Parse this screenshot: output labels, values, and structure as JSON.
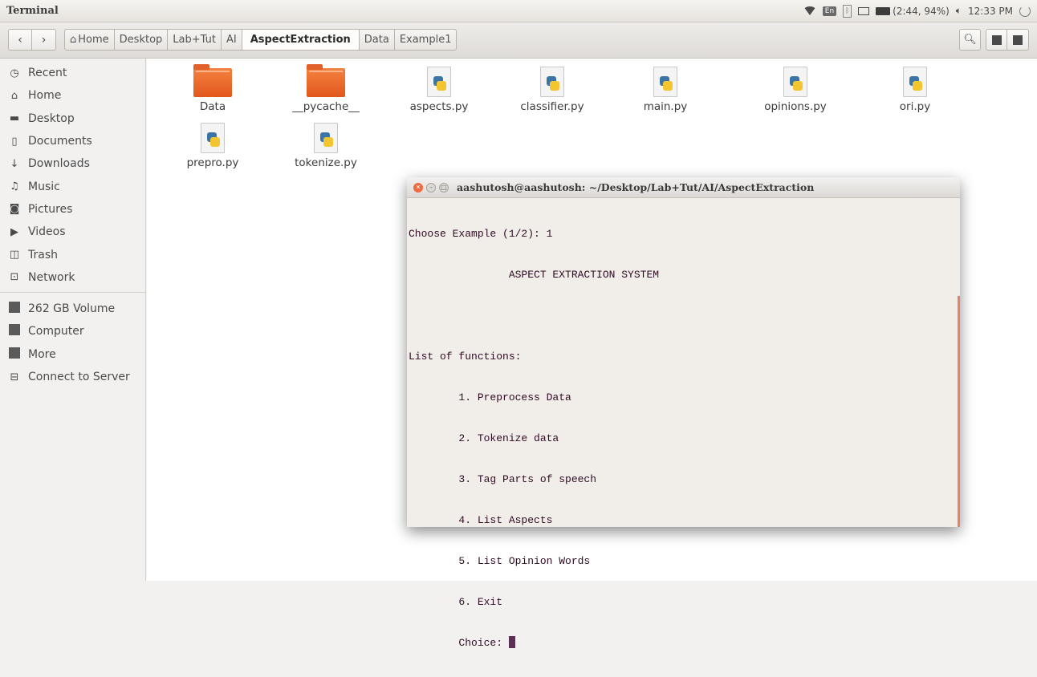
{
  "top_panel": {
    "app_title": "Terminal",
    "keyboard_layout": "En",
    "battery": "(2:44, 94%)",
    "clock": "12:33 PM"
  },
  "toolbar": {
    "back_icon": "chevron-left",
    "forward_icon": "chevron-right",
    "breadcrumbs": [
      "Home",
      "Desktop",
      "Lab+Tut",
      "AI",
      "AspectExtraction",
      "Data",
      "Example1"
    ],
    "active_crumb": "AspectExtraction"
  },
  "sidebar": {
    "places": [
      {
        "label": "Recent",
        "icon": "clock-icon"
      },
      {
        "label": "Home",
        "icon": "home-icon"
      },
      {
        "label": "Desktop",
        "icon": "desktop-folder-icon"
      },
      {
        "label": "Documents",
        "icon": "document-icon"
      },
      {
        "label": "Downloads",
        "icon": "download-icon"
      },
      {
        "label": "Music",
        "icon": "music-icon"
      },
      {
        "label": "Pictures",
        "icon": "camera-icon"
      },
      {
        "label": "Videos",
        "icon": "video-icon"
      },
      {
        "label": "Trash",
        "icon": "trash-icon"
      },
      {
        "label": "Network",
        "icon": "network-icon"
      }
    ],
    "devices": [
      {
        "label": "262 GB Volume",
        "icon": "drive-icon"
      },
      {
        "label": "Computer",
        "icon": "drive-icon"
      },
      {
        "label": "More",
        "icon": "drive-icon"
      },
      {
        "label": "Connect to Server",
        "icon": "server-icon"
      }
    ]
  },
  "files": [
    {
      "name": "Data",
      "type": "folder"
    },
    {
      "name": "__pycache__",
      "type": "folder"
    },
    {
      "name": "aspects.py",
      "type": "python"
    },
    {
      "name": "classifier.py",
      "type": "python"
    },
    {
      "name": "main.py",
      "type": "python"
    },
    {
      "name": "opinions.py",
      "type": "python"
    },
    {
      "name": "ori.py",
      "type": "python"
    },
    {
      "name": "prepro.py",
      "type": "python"
    },
    {
      "name": "tokenize.py",
      "type": "python"
    }
  ],
  "terminal": {
    "title": "aashutosh@aashutosh: ~/Desktop/Lab+Tut/AI/AspectExtraction",
    "lines": [
      "Choose Example (1/2): 1",
      "                ASPECT EXTRACTION SYSTEM",
      "",
      "List of functions:",
      "        1. Preprocess Data",
      "        2. Tokenize data",
      "        3. Tag Parts of speech",
      "        4. List Aspects",
      "        5. List Opinion Words",
      "        6. Exit"
    ],
    "prompt": "        Choice: "
  },
  "colors": {
    "terminal_text": "#300a24",
    "terminal_bg": "#f1eee9",
    "folder_orange": "#e2571d",
    "close_button": "#f0683f",
    "cursor": "#5d2f55"
  }
}
